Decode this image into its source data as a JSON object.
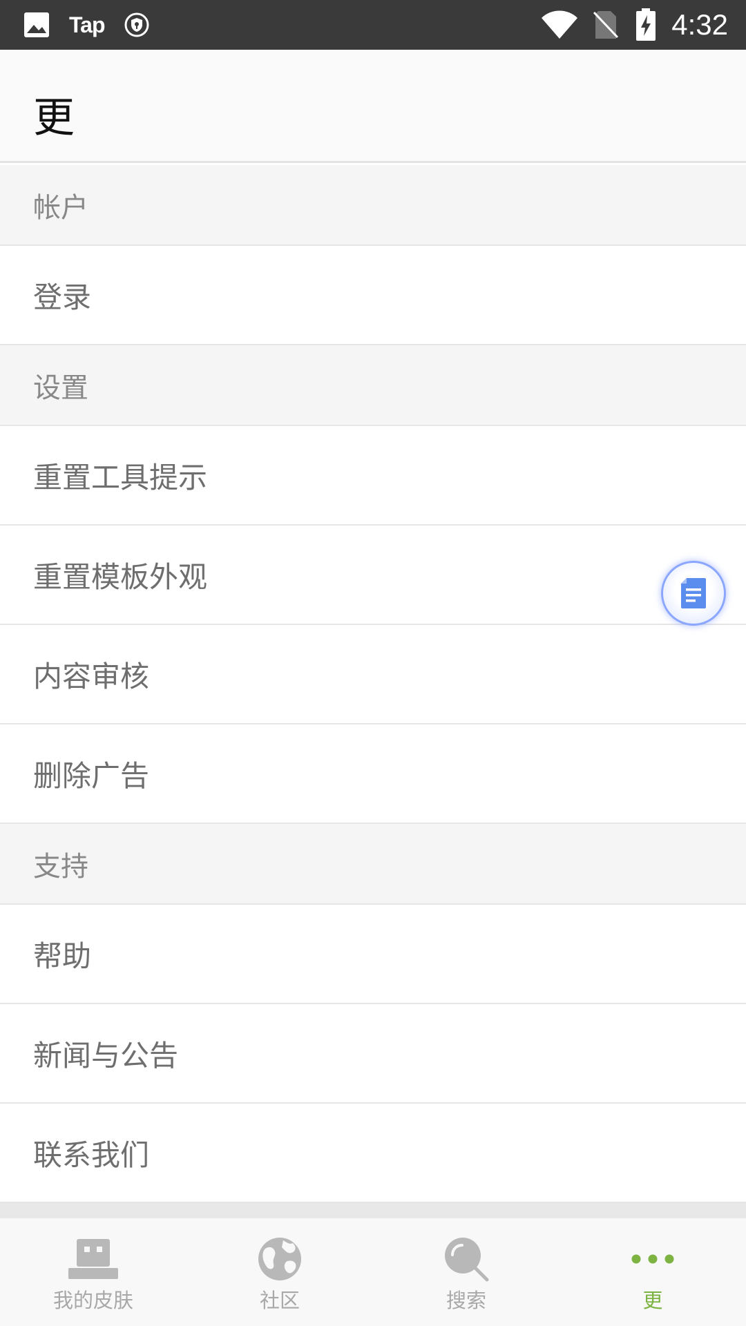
{
  "status_bar": {
    "app_label": "Tap",
    "time": "4:32",
    "icons": [
      "image-icon",
      "vpn-shield-icon",
      "wifi-icon",
      "no-sim-icon",
      "battery-charging-icon"
    ]
  },
  "header": {
    "title": "更"
  },
  "sections": [
    {
      "title": "帐户",
      "items": [
        "登录"
      ]
    },
    {
      "title": "设置",
      "items": [
        "重置工具提示",
        "重置模板外观",
        "内容审核",
        "删除广告"
      ]
    },
    {
      "title": "支持",
      "items": [
        "帮助",
        "新闻与公告",
        "联系我们"
      ]
    }
  ],
  "fab": {
    "icon": "document-icon",
    "color": "#5b8def"
  },
  "bottom_nav": {
    "tabs": [
      {
        "label": "我的皮肤",
        "icon": "skin-icon"
      },
      {
        "label": "社区",
        "icon": "globe-icon"
      },
      {
        "label": "搜索",
        "icon": "search-icon"
      },
      {
        "label": "更",
        "icon": "more-dots-icon",
        "active": true
      }
    ],
    "active_color": "#7cb342",
    "inactive_color": "#a8a8a8"
  }
}
